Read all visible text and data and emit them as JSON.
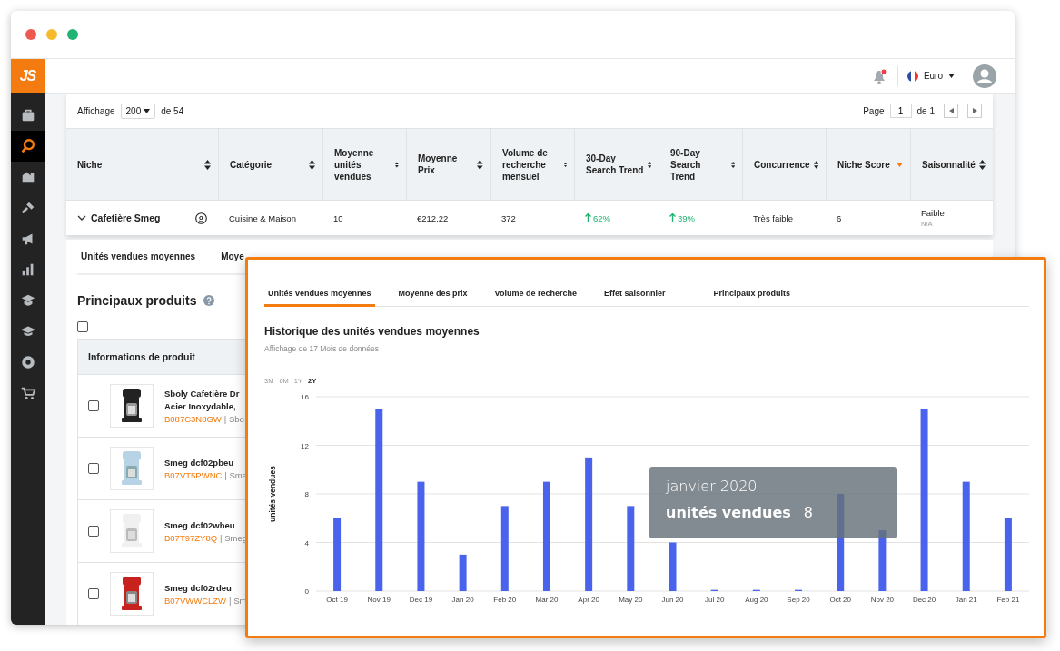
{
  "sidebar": {
    "logo": "JS",
    "items": [
      {
        "selected": false
      },
      {
        "selected": true
      },
      {
        "selected": false
      },
      {
        "selected": false
      },
      {
        "selected": false
      },
      {
        "selected": false
      },
      {
        "selected": false
      },
      {
        "selected": false
      },
      {
        "selected": false
      },
      {
        "selected": false
      }
    ]
  },
  "header": {
    "has_notification": true,
    "currency": "Euro"
  },
  "toolbar": {
    "label": "Affichage",
    "page_size": "200",
    "total": "de 54",
    "page_label": "Page",
    "page": "1",
    "page_total": "de 1"
  },
  "table": {
    "columns": [
      {
        "label": "Niche",
        "sorted": false
      },
      {
        "label": "Catégorie",
        "sorted": false
      },
      {
        "label": "Moyenne unités vendues",
        "sorted": false
      },
      {
        "label": "Moyenne Prix",
        "sorted": false
      },
      {
        "label": "Volume de recherche mensuel",
        "sorted": false
      },
      {
        "label": "30-Day Search Trend",
        "sorted": false
      },
      {
        "label": "90-Day Search Trend",
        "sorted": false
      },
      {
        "label": "Concurrence",
        "sorted": false
      },
      {
        "label": "Niche Score",
        "sorted": true
      },
      {
        "label": "Saisonnalité",
        "sorted": false
      }
    ],
    "rows": [
      {
        "expanded": true,
        "niche": "Cafetière Smeg",
        "category": "Cuisine & Maison",
        "units": "10",
        "price": "€212.22",
        "volume": "372",
        "trend_30": {
          "text": "62%",
          "rising": true
        },
        "trend_90": {
          "text": "39%",
          "rising": true
        },
        "competition": "Très faible",
        "score": "6",
        "seasonality": "Faible",
        "seasonality_note": "N/A"
      }
    ]
  },
  "detail_tabs": [
    {
      "label": "Unités vendues moyennes"
    },
    {
      "label": "Moye"
    }
  ],
  "products": {
    "title": "Principaux produits",
    "select_all_checked": false,
    "column": "Informations de produit",
    "rows": [
      {
        "name_lines": [
          "Sboly Cafetière Dr",
          "Acier Inoxydable, "
        ],
        "asin": "B087C3N8GW",
        "brand": "| Sbo",
        "checked": false
      },
      {
        "name_lines": [
          "Smeg dcf02pbeu"
        ],
        "asin": "B07VT5PWNC",
        "brand": "| Sme",
        "checked": false
      },
      {
        "name_lines": [
          "Smeg dcf02wheu"
        ],
        "asin": "B07T97ZY8Q",
        "brand": "| Smeg",
        "checked": false
      },
      {
        "name_lines": [
          "Smeg dcf02rdeu"
        ],
        "asin": "B07VWWCLZW",
        "brand": "| Sm",
        "checked": false
      }
    ]
  },
  "popup": {
    "tabs": [
      {
        "label": "Unités vendues moyennes",
        "selected": true
      },
      {
        "label": "Moyenne des prix",
        "selected": false
      },
      {
        "label": "Volume de recherche",
        "selected": false
      },
      {
        "label": "Effet saisonnier",
        "selected": false
      },
      {
        "label": "Principaux produits",
        "selected": false
      }
    ],
    "title": "Historique des unités vendues moyennes",
    "subtitle": "Affichage de 17 Mois de données",
    "ranges": [
      {
        "label": "3M",
        "selected": false
      },
      {
        "label": "6M",
        "selected": false
      },
      {
        "label": "1Y",
        "selected": false
      },
      {
        "label": "2Y",
        "selected": true
      }
    ],
    "chart_data": {
      "type": "bar",
      "ylabel": "unités vendues",
      "categories": [
        "Oct 19",
        "Nov 19",
        "Dec 19",
        "Jan 20",
        "Feb 20",
        "Mar 20",
        "Apr 20",
        "May 20",
        "Jun 20",
        "Jul 20",
        "Aug 20",
        "Sep 20",
        "Oct 20",
        "Nov 20",
        "Dec 20",
        "Jan 21",
        "Feb 21"
      ],
      "series": [
        {
          "color": "#4a63ec",
          "values": [
            6,
            15,
            9,
            3,
            7,
            9,
            11,
            7,
            4,
            0.1,
            0.1,
            0.1,
            8,
            5,
            15,
            9,
            6
          ]
        }
      ],
      "ylim": [
        0,
        16
      ],
      "yticks": [
        0,
        4,
        8,
        12,
        16
      ],
      "grid": true
    },
    "tooltip": {
      "title": "janvier 2020",
      "label": "unités vendues",
      "value": "8"
    }
  }
}
